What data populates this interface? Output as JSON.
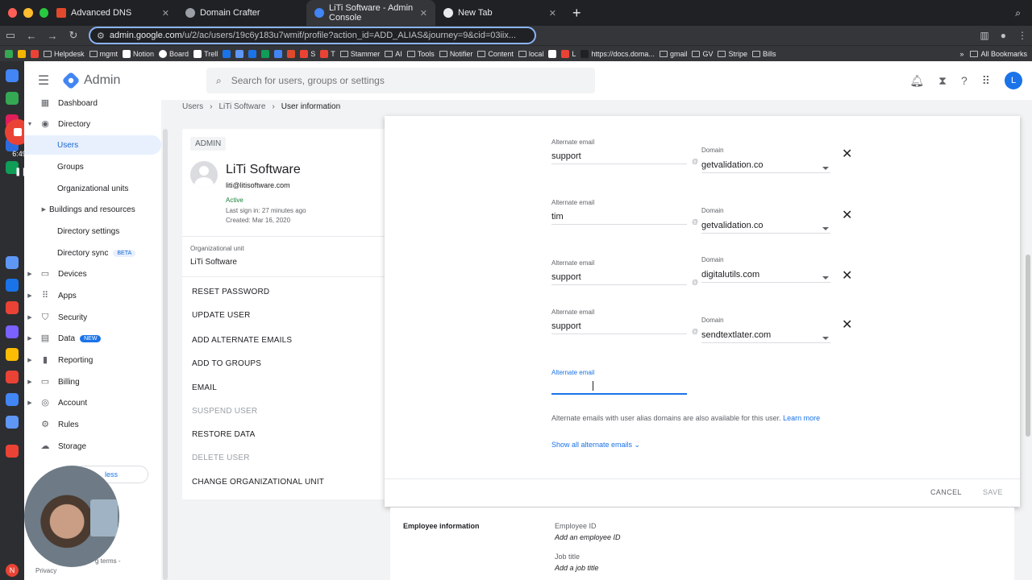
{
  "browser": {
    "tabs": [
      {
        "title": "Advanced DNS",
        "color": "#e0492c"
      },
      {
        "title": "Domain Crafter",
        "color": "#9aa0a6"
      },
      {
        "title": "LiTi Software - Admin Console",
        "color": "#4285f4"
      },
      {
        "title": "New Tab",
        "color": "#e8eaed"
      }
    ],
    "url_host": "admin.google.com",
    "url_path": "/u/2/ac/users/19c6y183u7wmif/profile?action_id=ADD_ALIAS&journey=9&cid=03iix...",
    "bookmarks": [
      "Helpdesk",
      "mgmt",
      "Notion",
      "Board",
      "Trell",
      "S",
      "T",
      "Stammer",
      "AI",
      "Tools",
      "Notifier",
      "Content",
      "local",
      "L",
      "https://docs.doma...",
      "gmail",
      "GV",
      "Stripe",
      "Bills"
    ],
    "all_bookmarks": "All Bookmarks"
  },
  "dock": {
    "time": "6:49"
  },
  "header": {
    "product": "Admin",
    "search_placeholder": "Search for users, groups or settings",
    "avatar_letter": "L"
  },
  "sidebar": {
    "items": [
      {
        "label": "Dashboard",
        "icon": "▦"
      },
      {
        "label": "Directory",
        "icon": "👤"
      },
      {
        "label": "Users"
      },
      {
        "label": "Groups"
      },
      {
        "label": "Organizational units"
      },
      {
        "label": "Buildings and resources"
      },
      {
        "label": "Directory settings"
      },
      {
        "label": "Directory sync",
        "badge": "BETA"
      },
      {
        "label": "Devices",
        "icon": "▭"
      },
      {
        "label": "Apps",
        "icon": "⠿"
      },
      {
        "label": "Security",
        "icon": "⛉"
      },
      {
        "label": "Data",
        "icon": "▤",
        "badge": "NEW"
      },
      {
        "label": "Reporting",
        "icon": "▮"
      },
      {
        "label": "Billing",
        "icon": "▭"
      },
      {
        "label": "Account",
        "icon": "◎"
      },
      {
        "label": "Rules",
        "icon": "⚙"
      },
      {
        "label": "Storage",
        "icon": "☁"
      }
    ],
    "help_pill": "less",
    "footer_terms": "g terms -",
    "footer_privacy": "Privacy"
  },
  "breadcrumbs": {
    "users": "Users",
    "org": "LiTi Software",
    "current": "User information"
  },
  "user": {
    "chip": "ADMIN",
    "name": "LiTi Software",
    "email": "liti@litisoftware.com",
    "status": "Active",
    "last_signin": "Last sign in: 27 minutes ago",
    "created": "Created: Mar 16, 2020",
    "ou_label": "Organizational unit",
    "ou_value": "LiTi Software",
    "actions": [
      {
        "label": "RESET PASSWORD",
        "disabled": false
      },
      {
        "label": "UPDATE USER",
        "disabled": false
      },
      {
        "label": "ADD ALTERNATE EMAILS",
        "disabled": false
      },
      {
        "label": "ADD TO GROUPS",
        "disabled": false
      },
      {
        "label": "EMAIL",
        "disabled": false
      },
      {
        "label": "SUSPEND USER",
        "disabled": true
      },
      {
        "label": "RESTORE DATA",
        "disabled": false
      },
      {
        "label": "DELETE USER",
        "disabled": true
      },
      {
        "label": "CHANGE ORGANIZATIONAL UNIT",
        "disabled": false
      }
    ]
  },
  "dialog": {
    "alt_label": "Alternate email",
    "domain_label": "Domain",
    "at": "@",
    "aliases": [
      {
        "alias": "support",
        "domain": "getvalidation.co"
      },
      {
        "alias": "tim",
        "domain": "getvalidation.co"
      },
      {
        "alias": "support",
        "domain": "digitalutils.com"
      },
      {
        "alias": "support",
        "domain": "sendtextlater.com"
      }
    ],
    "new_alias_label": "Alternate email",
    "new_alias_value": "",
    "hint": "Alternate emails with user alias domains are also available for this user.",
    "learn_more": "Learn more",
    "show_all": "Show all alternate emails ⌄",
    "cancel": "CANCEL",
    "save": "SAVE"
  },
  "employee": {
    "heading": "Employee information",
    "id_label": "Employee ID",
    "id_value": "Add an employee ID",
    "title_label": "Job title",
    "title_value": "Add a job title"
  }
}
